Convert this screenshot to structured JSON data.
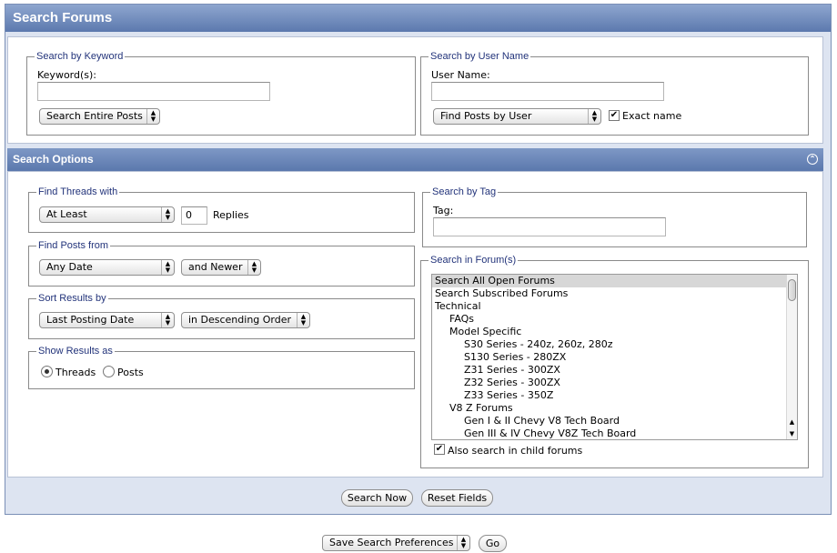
{
  "header": {
    "title": "Search Forums"
  },
  "keyword_section": {
    "legend": "Search by Keyword",
    "label": "Keyword(s):",
    "value": "",
    "scope_select": "Search Entire Posts"
  },
  "username_section": {
    "legend": "Search by User Name",
    "label": "User Name:",
    "value": "",
    "find_select": "Find Posts by User",
    "exact_name_checked": true,
    "exact_name_label": "Exact name"
  },
  "options": {
    "title": "Search Options",
    "collapse_icon": "chevron-up-icon",
    "find_threads": {
      "legend": "Find Threads with",
      "select": "At Least",
      "count": "0",
      "suffix": "Replies"
    },
    "find_posts": {
      "legend": "Find Posts from",
      "date_select": "Any Date",
      "range_select": "and Newer"
    },
    "sort": {
      "legend": "Sort Results by",
      "field_select": "Last Posting Date",
      "order_select": "in Descending Order"
    },
    "show_as": {
      "legend": "Show Results as",
      "options": [
        "Threads",
        "Posts"
      ],
      "selected": "Threads"
    },
    "tag": {
      "legend": "Search by Tag",
      "label": "Tag:",
      "value": ""
    },
    "forums": {
      "legend": "Search in Forum(s)",
      "items": [
        {
          "label": "Search All Open Forums",
          "depth": 0,
          "selected": true
        },
        {
          "label": "Search Subscribed Forums",
          "depth": 0,
          "selected": false
        },
        {
          "label": "Technical",
          "depth": 0,
          "selected": false
        },
        {
          "label": "FAQs",
          "depth": 1,
          "selected": false
        },
        {
          "label": "Model Specific",
          "depth": 1,
          "selected": false
        },
        {
          "label": "S30 Series - 240z, 260z, 280z",
          "depth": 2,
          "selected": false
        },
        {
          "label": "S130 Series - 280ZX",
          "depth": 2,
          "selected": false
        },
        {
          "label": "Z31 Series - 300ZX",
          "depth": 2,
          "selected": false
        },
        {
          "label": "Z32 Series - 300ZX",
          "depth": 2,
          "selected": false
        },
        {
          "label": "Z33 Series - 350Z",
          "depth": 2,
          "selected": false
        },
        {
          "label": "V8 Z Forums",
          "depth": 1,
          "selected": false
        },
        {
          "label": "Gen I & II Chevy V8 Tech Board",
          "depth": 2,
          "selected": false
        },
        {
          "label": "Gen III & IV Chevy V8Z Tech Board",
          "depth": 2,
          "selected": false
        }
      ],
      "child_checked": true,
      "child_label": "Also search in child forums"
    }
  },
  "actions": {
    "search_now": "Search Now",
    "reset_fields": "Reset Fields"
  },
  "footer": {
    "preferences_select": "Save Search Preferences",
    "go": "Go"
  }
}
